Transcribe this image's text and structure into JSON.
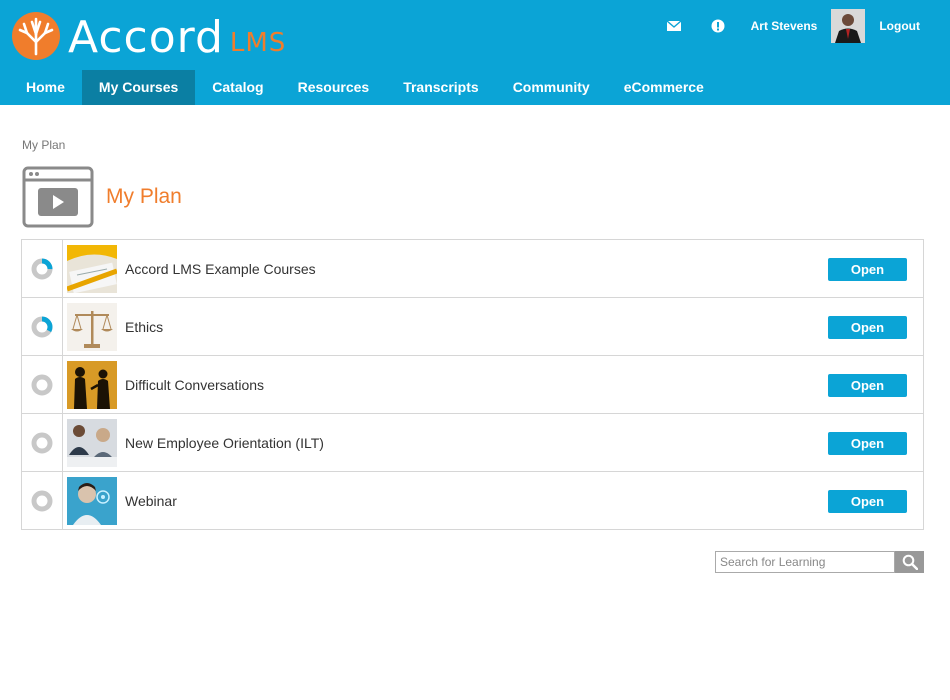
{
  "brand": {
    "name": "Accord",
    "suffix": "LMS"
  },
  "header": {
    "user_name": "Art Stevens",
    "logout_label": "Logout",
    "icons": [
      "mail-icon",
      "alert-icon"
    ]
  },
  "nav": {
    "items": [
      {
        "label": "Home"
      },
      {
        "label": "My Courses",
        "active": true
      },
      {
        "label": "Catalog"
      },
      {
        "label": "Resources"
      },
      {
        "label": "Transcripts"
      },
      {
        "label": "Community"
      },
      {
        "label": "eCommerce"
      }
    ]
  },
  "breadcrumb": "My Plan",
  "page": {
    "title": "My Plan",
    "icon": "video-player-icon"
  },
  "courses": [
    {
      "name": "Accord LMS Example Courses",
      "progress": 0.25,
      "button": "Open",
      "thumb": "construction-tools"
    },
    {
      "name": "Ethics",
      "progress": 0.33,
      "button": "Open",
      "thumb": "scales-of-justice"
    },
    {
      "name": "Difficult Conversations",
      "progress": 0,
      "button": "Open",
      "thumb": "silhouettes-talking"
    },
    {
      "name": "New Employee Orientation (ILT)",
      "progress": 0,
      "button": "Open",
      "thumb": "business-meeting"
    },
    {
      "name": "Webinar",
      "progress": 0,
      "button": "Open",
      "thumb": "woman-touchscreen"
    }
  ],
  "search": {
    "placeholder": "Search for Learning"
  },
  "colors": {
    "header": "#0ba4d6",
    "nav_active": "#0b7fa3",
    "accent": "#f07d2c",
    "button": "#0ba4d6",
    "ring_empty": "#c8c8c8"
  }
}
